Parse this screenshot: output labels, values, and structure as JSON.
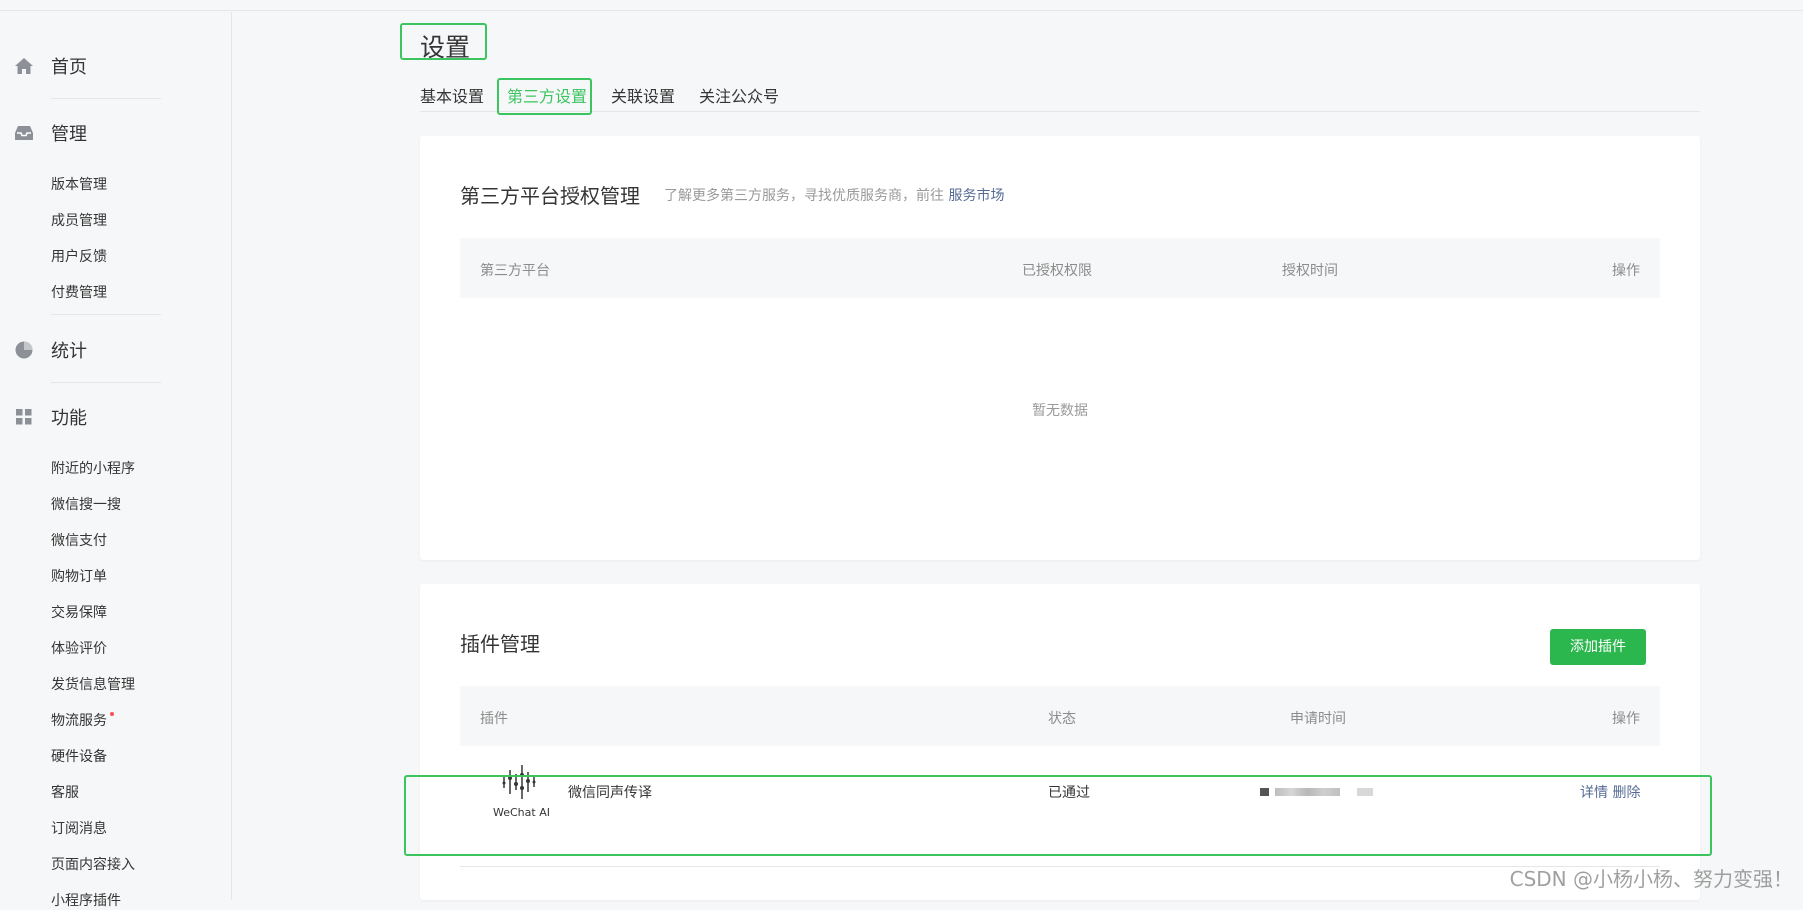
{
  "sidebar": {
    "sections": [
      {
        "label": "首页",
        "icon": "home-icon",
        "items": []
      },
      {
        "label": "管理",
        "icon": "inbox-icon",
        "items": [
          "版本管理",
          "成员管理",
          "用户反馈",
          "付费管理"
        ]
      },
      {
        "label": "统计",
        "icon": "pie-chart-icon",
        "items": []
      },
      {
        "label": "功能",
        "icon": "grid-icon",
        "items": [
          "附近的小程序",
          "微信搜一搜",
          "微信支付",
          "购物订单",
          "交易保障",
          "体验评价",
          "发货信息管理",
          "物流服务",
          "硬件设备",
          "客服",
          "订阅消息",
          "页面内容接入",
          "小程序插件"
        ]
      }
    ]
  },
  "page": {
    "title": "设置",
    "tabs": [
      {
        "label": "基本设置",
        "active": false
      },
      {
        "label": "第三方设置",
        "active": true
      },
      {
        "label": "关联设置",
        "active": false
      },
      {
        "label": "关注公众号",
        "active": false
      }
    ]
  },
  "third_party": {
    "title": "第三方平台授权管理",
    "subtitle_prefix": "了解更多第三方服务，寻找优质服务商，前往",
    "subtitle_link": "服务市场",
    "columns": [
      "第三方平台",
      "已授权权限",
      "授权时间",
      "操作"
    ],
    "empty_text": "暂无数据"
  },
  "plugins": {
    "title": "插件管理",
    "add_button": "添加插件",
    "columns": [
      "插件",
      "状态",
      "申请时间",
      "操作"
    ],
    "rows": [
      {
        "logo_text": "WeChat AI",
        "name": "微信同声传译",
        "status": "已通过",
        "actions": [
          "详情",
          "删除"
        ]
      }
    ]
  },
  "watermark": "CSDN @小杨小杨、努力变强！",
  "colors": {
    "accent": "#3cc55f",
    "link": "#576b95",
    "button": "#2bb74e"
  }
}
